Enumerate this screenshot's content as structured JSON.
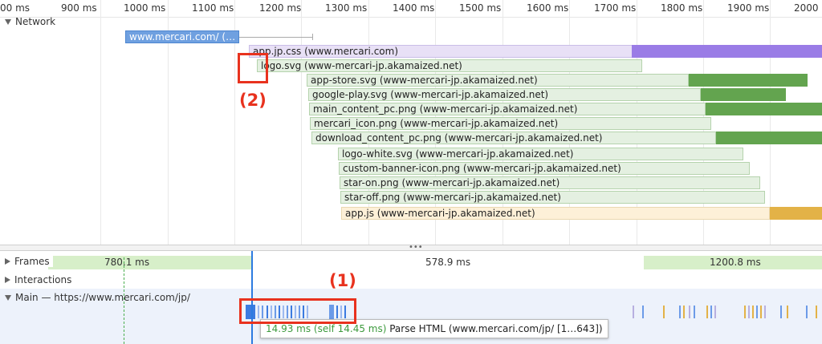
{
  "ruler": {
    "ticks": [
      "00 ms",
      "900 ms",
      "1000 ms",
      "1100 ms",
      "1200 ms",
      "1300 ms",
      "1400 ms",
      "1500 ms",
      "1600 ms",
      "1700 ms",
      "1800 ms",
      "1900 ms",
      "2000"
    ]
  },
  "network": {
    "label": "Network",
    "requests": [
      {
        "label": "www.mercari.com/ (…",
        "kind": "html"
      },
      {
        "label": "app.jp.css (www.mercari.com)",
        "kind": "css"
      },
      {
        "label": "logo.svg (www-mercari-jp.akamaized.net)",
        "kind": "img"
      },
      {
        "label": "app-store.svg (www-mercari-jp.akamaized.net)",
        "kind": "img"
      },
      {
        "label": "google-play.svg (www-mercari-jp.akamaized.net)",
        "kind": "img"
      },
      {
        "label": "main_content_pc.png (www-mercari-jp.akamaized.net)",
        "kind": "img"
      },
      {
        "label": "mercari_icon.png (www-mercari-jp.akamaized.net)",
        "kind": "img"
      },
      {
        "label": "download_content_pc.png (www-mercari-jp.akamaized.net)",
        "kind": "img"
      },
      {
        "label": "logo-white.svg (www-mercari-jp.akamaized.net)",
        "kind": "img"
      },
      {
        "label": "custom-banner-icon.png (www-mercari-jp.akamaized.net)",
        "kind": "img"
      },
      {
        "label": "star-on.png (www-mercari-jp.akamaized.net)",
        "kind": "img"
      },
      {
        "label": "star-off.png (www-mercari-jp.akamaized.net)",
        "kind": "img"
      },
      {
        "label": "app.js (www-mercari-jp.akamaized.net)",
        "kind": "js"
      }
    ]
  },
  "frames": {
    "label": "Frames",
    "durations": [
      "780.1 ms",
      "578.9 ms",
      "1200.8 ms"
    ]
  },
  "interactions": {
    "label": "Interactions"
  },
  "main": {
    "label": "Main — https://www.mercari.com/jp/"
  },
  "tooltip": {
    "time": "14.93 ms (self 14.45 ms)",
    "text": "Parse HTML (www.mercari.com/jp/ [1…643])"
  },
  "annotations": {
    "one": "(1)",
    "two": "(2)"
  },
  "colors": {
    "html": "#6fa0e0",
    "css": "#9a7ce6",
    "img": "#63a44f",
    "js": "#e3b247",
    "annotation": "#e8321e",
    "frames": "#d7efc9"
  }
}
